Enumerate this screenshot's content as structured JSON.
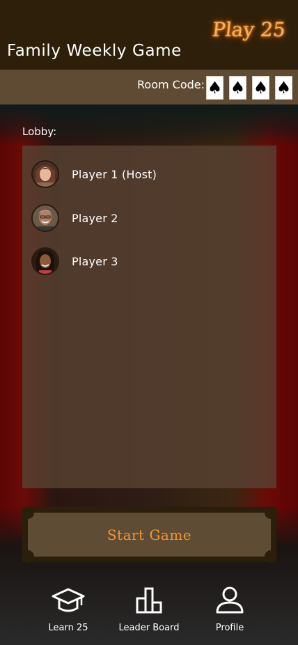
{
  "header": {
    "title": "Family Weekly Game",
    "brand": "Play 25"
  },
  "room": {
    "label": "Room Code:",
    "cards": [
      "♠",
      "♠",
      "♠",
      "♠"
    ]
  },
  "lobby": {
    "label": "Lobby:",
    "players": [
      {
        "name": "Player 1 (Host)",
        "avatar": "avatar-1"
      },
      {
        "name": "Player 2",
        "avatar": "avatar-2"
      },
      {
        "name": "Player 3",
        "avatar": "avatar-3"
      }
    ]
  },
  "actions": {
    "start_label": "Start Game"
  },
  "nav": {
    "items": [
      {
        "label": "Learn 25",
        "icon": "graduation-cap-icon"
      },
      {
        "label": "Leader Board",
        "icon": "leaderboard-icon"
      },
      {
        "label": "Profile",
        "icon": "profile-icon"
      }
    ]
  },
  "colors": {
    "header_bg": "#2e1f0a",
    "room_bar_bg": "#5f4b33",
    "accent_orange": "#f19632"
  }
}
